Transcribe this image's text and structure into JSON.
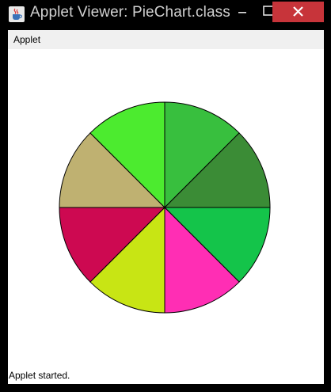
{
  "window": {
    "title": "Applet Viewer: PieChart.class",
    "icon": "java-coffee-icon",
    "controls": [
      "minimize-icon",
      "maximize-icon",
      "close-icon"
    ],
    "close_color": "#c7343a"
  },
  "menubar": {
    "items": [
      "Applet"
    ]
  },
  "status": {
    "text": "Applet started."
  },
  "chart_data": {
    "type": "pie",
    "title": "",
    "values": [
      1,
      1,
      1,
      1,
      1,
      1,
      1,
      1
    ],
    "colors": [
      "#38bf3e",
      "#3b8c36",
      "#14c44a",
      "#ff2eb4",
      "#c8e514",
      "#cd0951",
      "#bfb171",
      "#4ceb2f"
    ],
    "start_direction": "up",
    "direction": "clockwise"
  }
}
